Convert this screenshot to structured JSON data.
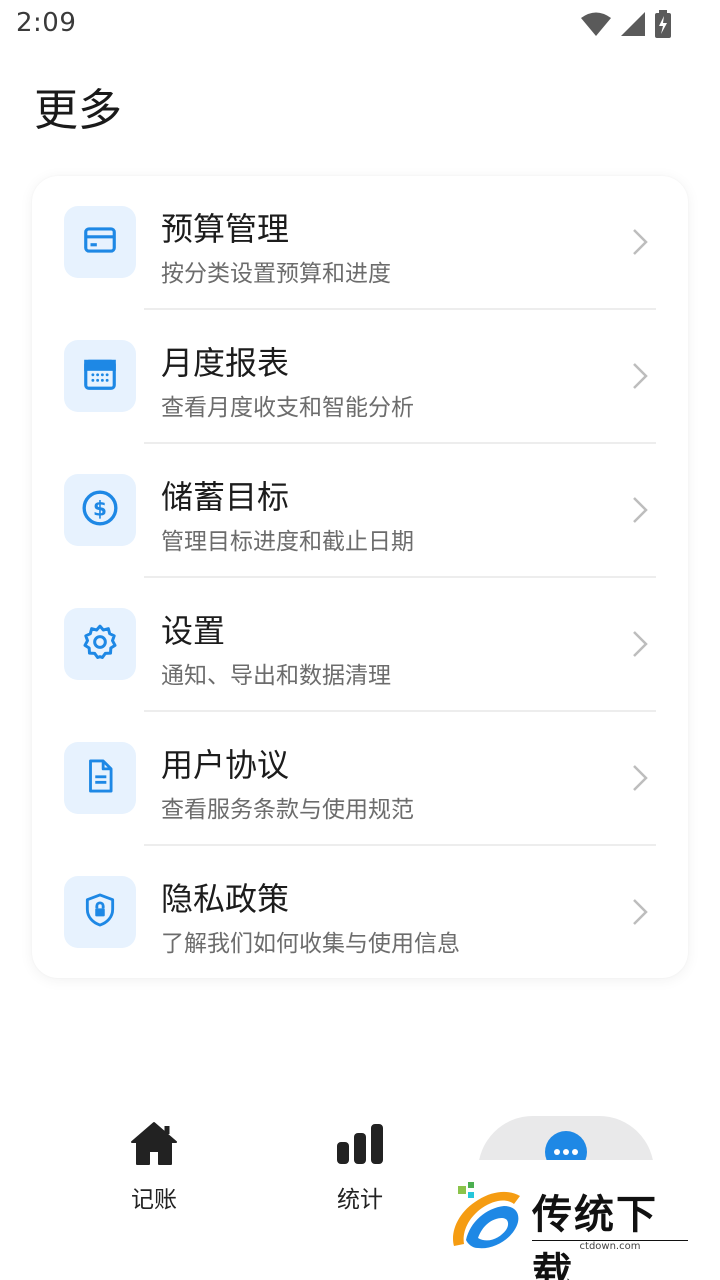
{
  "status_bar": {
    "time": "2:09",
    "icons": [
      "wifi-icon",
      "cellular-icon",
      "battery-charging-icon"
    ]
  },
  "page": {
    "title": "更多"
  },
  "menu": {
    "items": [
      {
        "icon": "credit-card-icon",
        "title": "预算管理",
        "subtitle": "按分类设置预算和进度"
      },
      {
        "icon": "calendar-icon",
        "title": "月度报表",
        "subtitle": "查看月度收支和智能分析"
      },
      {
        "icon": "dollar-circle-icon",
        "title": "储蓄目标",
        "subtitle": "管理目标进度和截止日期"
      },
      {
        "icon": "gear-icon",
        "title": "设置",
        "subtitle": "通知、导出和数据清理"
      },
      {
        "icon": "document-icon",
        "title": "用户协议",
        "subtitle": "查看服务条款与使用规范"
      },
      {
        "icon": "shield-lock-icon",
        "title": "隐私政策",
        "subtitle": "了解我们如何收集与使用信息"
      }
    ]
  },
  "bottom_nav": {
    "tabs": [
      {
        "icon": "home-icon",
        "label": "记账"
      },
      {
        "icon": "bar-chart-icon",
        "label": "统计"
      },
      {
        "icon": "more-dots-icon",
        "label": ""
      }
    ]
  },
  "watermark": {
    "text": "传统下载",
    "sub": "ctdown.com"
  },
  "colors": {
    "accent": "#1e88e5",
    "icon_tile": "#e7f2fe",
    "divider": "#ededed",
    "subtitle": "#6c6c6c"
  }
}
